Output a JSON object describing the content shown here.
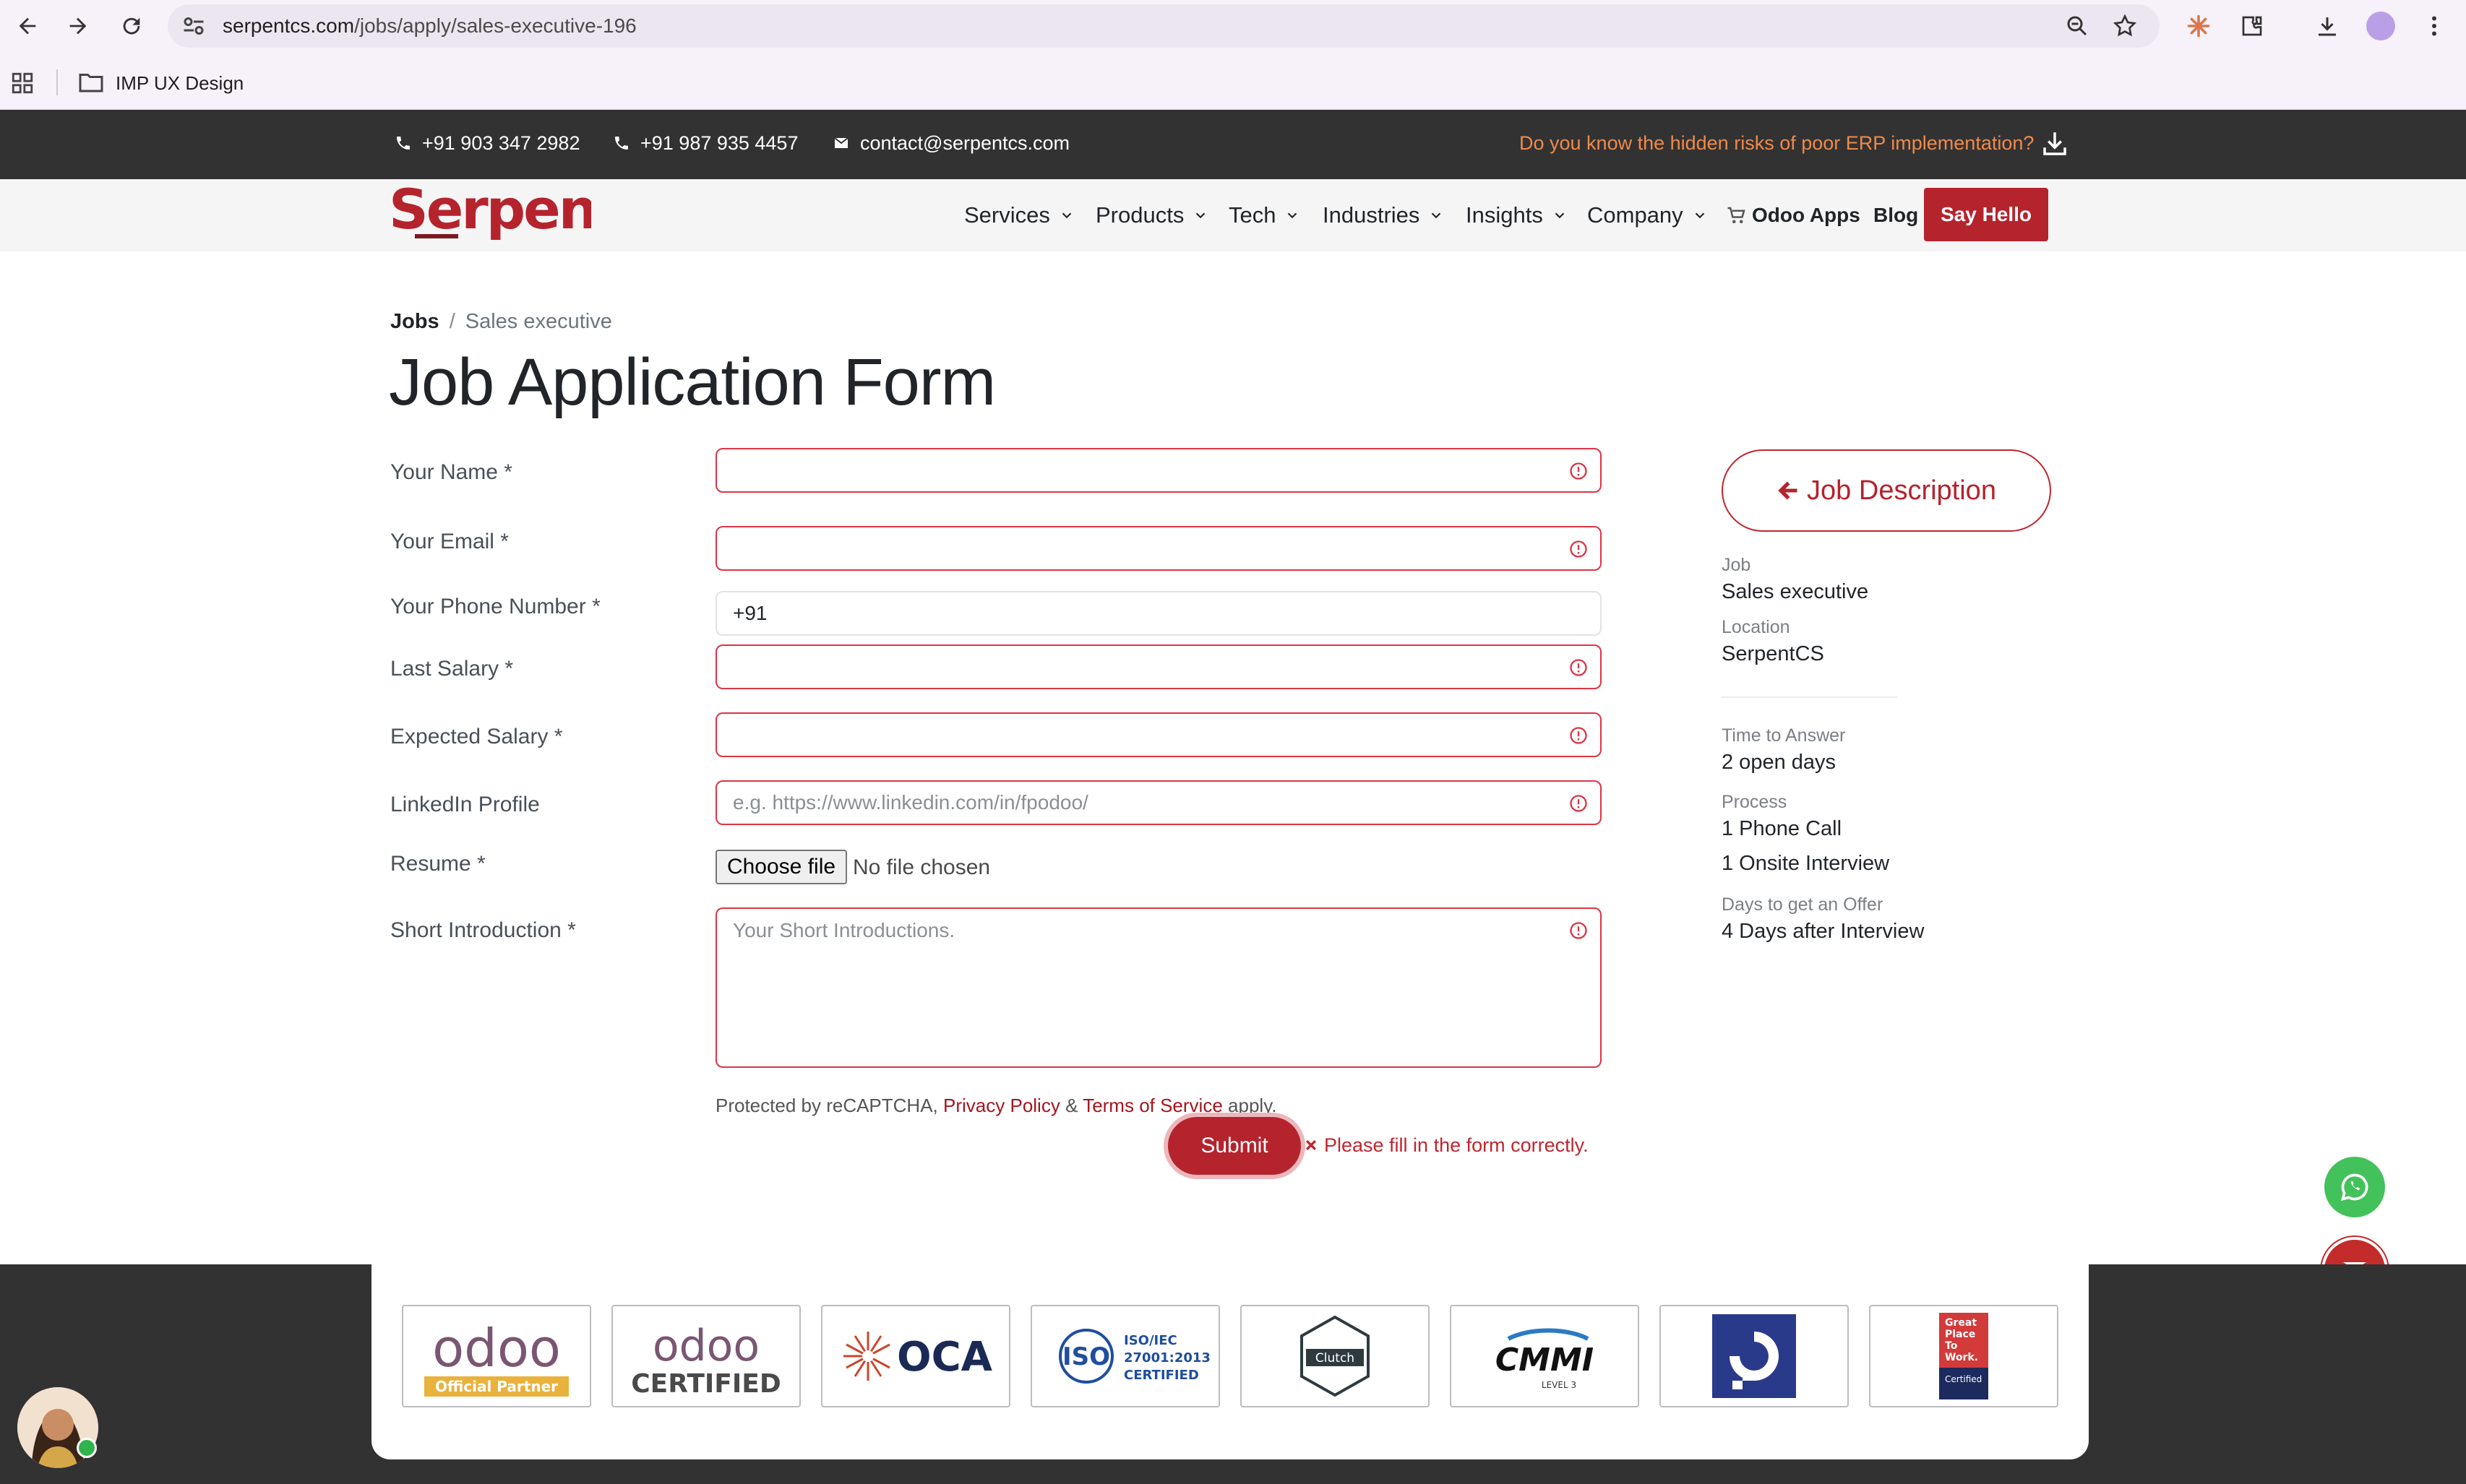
{
  "browser": {
    "url_host": "serpentcs.com",
    "url_path": "/jobs/apply/sales-executive-196",
    "bookmark_folder": "IMP UX Design"
  },
  "topbar": {
    "phone1": "+91 903 347 2982",
    "phone2": "+91 987 935 4457",
    "email": "contact@serpentcs.com",
    "promo": "Do you know the hidden risks of poor ERP implementation?"
  },
  "brand": {
    "logo_text": "Serpent",
    "logo_color": "#b5232d"
  },
  "nav": {
    "items": [
      "Services",
      "Products",
      "Tech",
      "Industries",
      "Insights",
      "Company"
    ],
    "odoo_apps": "Odoo Apps",
    "blog": "Blog",
    "cta": "Say Hello"
  },
  "breadcrumb": {
    "root": "Jobs",
    "separator": "/",
    "current": "Sales executive"
  },
  "page_title": "Job Application Form",
  "form": {
    "name_label": "Your Name *",
    "email_label": "Your Email *",
    "phone_label": "Your Phone Number *",
    "phone_value": "+91",
    "last_salary_label": "Last Salary *",
    "expected_salary_label": "Expected Salary *",
    "linkedin_label": "LinkedIn Profile",
    "linkedin_placeholder": "e.g. https://www.linkedin.com/in/fpodoo/",
    "resume_label": "Resume *",
    "choose_file": "Choose file",
    "no_file": "No file chosen",
    "intro_label": "Short Introduction *",
    "intro_placeholder": "Your Short Introductions.",
    "recaptcha_prefix": "Protected by reCAPTCHA,",
    "privacy": "Privacy Policy",
    "amp": "&",
    "terms": "Terms of Service",
    "apply": "apply.",
    "submit": "Submit",
    "error": "Please fill in the form correctly."
  },
  "sidebar": {
    "job_desc_btn": "Job Description",
    "job_label": "Job",
    "job_value": "Sales executive",
    "location_label": "Location",
    "location_value": "SerpentCS",
    "time_label": "Time to Answer",
    "time_value": "2 open days",
    "process_label": "Process",
    "process_step1": "1 Phone Call",
    "process_step2": "1 Onsite Interview",
    "offer_label": "Days to get an Offer",
    "offer_value": "4 Days after Interview"
  },
  "certs": {
    "odoo_partner_word": "odoo",
    "odoo_partner_tag": "Official Partner",
    "odoo_cert_word": "odoo",
    "odoo_cert_tag": "CERTIFIED",
    "oca": "OCA",
    "iso_word": "ISO",
    "iso_line1": "ISO/IEC",
    "iso_line2": "27001:2013",
    "iso_line3": "CERTIFIED",
    "clutch": "Clutch",
    "cmmi": "CMMI",
    "cmmi_level": "LEVEL 3",
    "gptw_line1": "Great",
    "gptw_line2": "Place",
    "gptw_line3": "To",
    "gptw_line4": "Work.",
    "gptw_line5": "Certified"
  },
  "colors": {
    "accent": "#b5232d",
    "error": "#dc3545",
    "dark_bar": "#323232",
    "promo": "#f08a4b",
    "whatsapp": "#43c15a",
    "phone_fab": "#2f66d6"
  }
}
